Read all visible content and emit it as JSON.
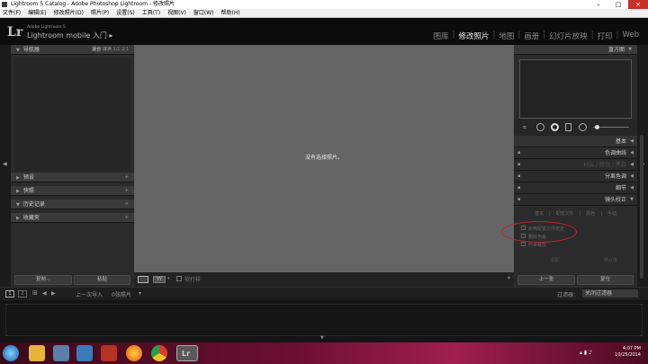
{
  "window": {
    "title": "Lightroom 5 Catalog - Adobe Photoshop Lightroom - 修改照片"
  },
  "menu": [
    "文件(F)",
    "编辑(E)",
    "修改照片(D)",
    "照片(P)",
    "设置(S)",
    "工具(T)",
    "视图(V)",
    "窗口(W)",
    "帮助(H)"
  ],
  "identity": {
    "logo": "Lr",
    "product": "Adobe Lightroom 5",
    "mobile": "Lightroom mobile 入门 ▸"
  },
  "modules": [
    "图库",
    "修改照片",
    "地图",
    "画册",
    "幻灯片放映",
    "打印",
    "Web"
  ],
  "active_module": "修改照片",
  "left_panel": {
    "navigator": {
      "title": "导航器",
      "options": [
        "适合",
        "填满",
        "1:1",
        "2:1"
      ]
    },
    "sections": [
      {
        "title": "预设",
        "action": "+"
      },
      {
        "title": "快照",
        "action": "+"
      },
      {
        "title": "历史记录",
        "action": "×"
      },
      {
        "title": "收藏夹",
        "action": "+"
      }
    ],
    "copy_btn": "复制...",
    "paste_btn": "粘贴"
  },
  "center": {
    "empty_message": "没有选择照片。"
  },
  "toolbar": {
    "softproof": "软打样"
  },
  "right_panel": {
    "histogram_title": "直方图",
    "sections": [
      "基本",
      "色调曲线",
      "HSL / 颜色 / 黑白",
      "分离色调",
      "细节",
      "镜头校正"
    ],
    "lens_tabs": [
      "基本",
      "配置文件",
      "颜色",
      "手动"
    ],
    "lens_options": [
      "启用配置文件校正",
      "删除色差",
      "约束裁剪"
    ],
    "lens_setup_label": "设置",
    "lens_setup_value": "默认值",
    "prev_btn": "上一张",
    "reset_btn": "复位"
  },
  "filmbar": {
    "page1": "1",
    "page2": "2",
    "breadcrumb": "上一次导入",
    "count": "0张照片",
    "filter_label": "过滤器：",
    "filter_value": "关闭过滤器"
  },
  "taskbar": {
    "time": "4:07 PM",
    "date": "10/25/2014"
  }
}
